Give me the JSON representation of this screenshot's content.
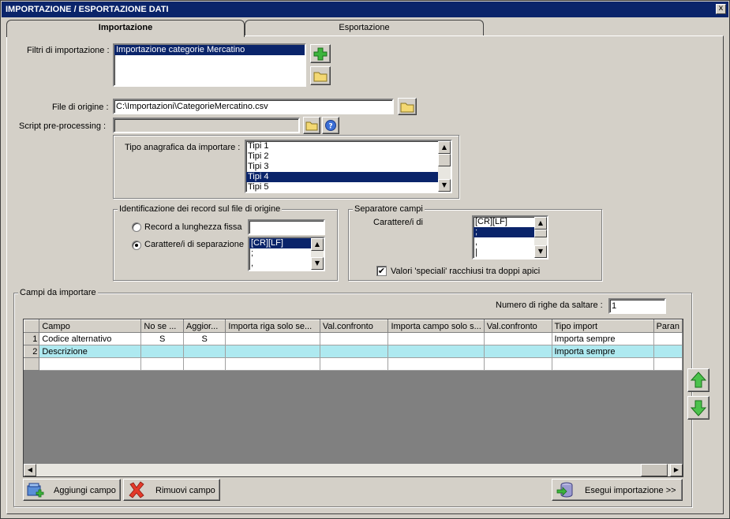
{
  "window": {
    "title": "IMPORTAZIONE / ESPORTAZIONE DATI",
    "close_glyph": "x"
  },
  "tabs": [
    {
      "label": "Importazione",
      "active": true
    },
    {
      "label": "Esportazione",
      "active": false
    }
  ],
  "filters": {
    "label": "Filtri di importazione :",
    "items": [
      "Importazione categorie Mercatino"
    ],
    "selected_index": 0
  },
  "source_file": {
    "label": "File di origine :",
    "value": "C:\\Importazioni\\CategorieMercatino.csv"
  },
  "script": {
    "label": "Script pre-processing :",
    "value": ""
  },
  "anagrafica": {
    "label": "Tipo anagrafica da importare :",
    "items": [
      "Tipi 1",
      "Tipi 2",
      "Tipi 3",
      "Tipi 4",
      "Tipi 5"
    ],
    "selected_index": 3
  },
  "record_id": {
    "group_title": "Identificazione dei record sul file di origine",
    "option_fixed": "Record a lunghezza fissa",
    "option_sep": "Carattere/i di separazione",
    "selected": "sep",
    "fixed_value": "",
    "sep_items": [
      "[CR][LF]",
      ";",
      ","
    ],
    "sep_selected_index": 0
  },
  "field_sep": {
    "group_title": "Separatore campi",
    "label": "Carattere/i di",
    "items": [
      "[CR][LF]",
      ";",
      ",",
      "|"
    ],
    "selected_index": 1,
    "quoted_label": "Valori 'speciali' racchiusi tra doppi apici",
    "quoted_checked": true,
    "check_glyph": "✔"
  },
  "fields": {
    "group_title": "Campi da importare",
    "skip_rows_label": "Numero di righe da saltare :",
    "skip_rows_value": "1",
    "columns": [
      "Campo",
      "No se ...",
      "Aggior...",
      "Importa riga solo se...",
      "Val.confronto",
      "Importa campo solo s...",
      "Val.confronto",
      "Tipo import",
      "Paran"
    ],
    "rows": [
      {
        "n": "1",
        "campo": "Codice alternativo",
        "nose": "S",
        "aggior": "S",
        "riga": "",
        "val1": "",
        "campo_se": "",
        "val2": "",
        "tipo": "Importa sempre",
        "param": ""
      },
      {
        "n": "2",
        "campo": "Descrizione",
        "nose": "",
        "aggior": "",
        "riga": "",
        "val1": "",
        "campo_se": "",
        "val2": "",
        "tipo": "Importa sempre",
        "param": ""
      }
    ],
    "selected_row": 1
  },
  "buttons": {
    "add_field": "Aggiungi campo",
    "remove_field": "Rimuovi campo",
    "run_import": "Esegui importazione >>"
  },
  "icons": {
    "add_filter": "plus-icon",
    "open_filter": "folder-icon",
    "browse_file": "folder-icon",
    "browse_script": "folder-icon",
    "help": "help-icon",
    "move_up": "arrow-up-icon",
    "move_down": "arrow-down-icon",
    "add_field": "add-field-icon",
    "remove_field": "remove-x-icon",
    "run_import": "database-import-icon"
  },
  "colors": {
    "title_bar": "#0a246a",
    "selection": "#0a246a",
    "grid_selected_row": "#aee9f0",
    "grid_empty_area": "#808080",
    "face": "#d4d0c8"
  }
}
